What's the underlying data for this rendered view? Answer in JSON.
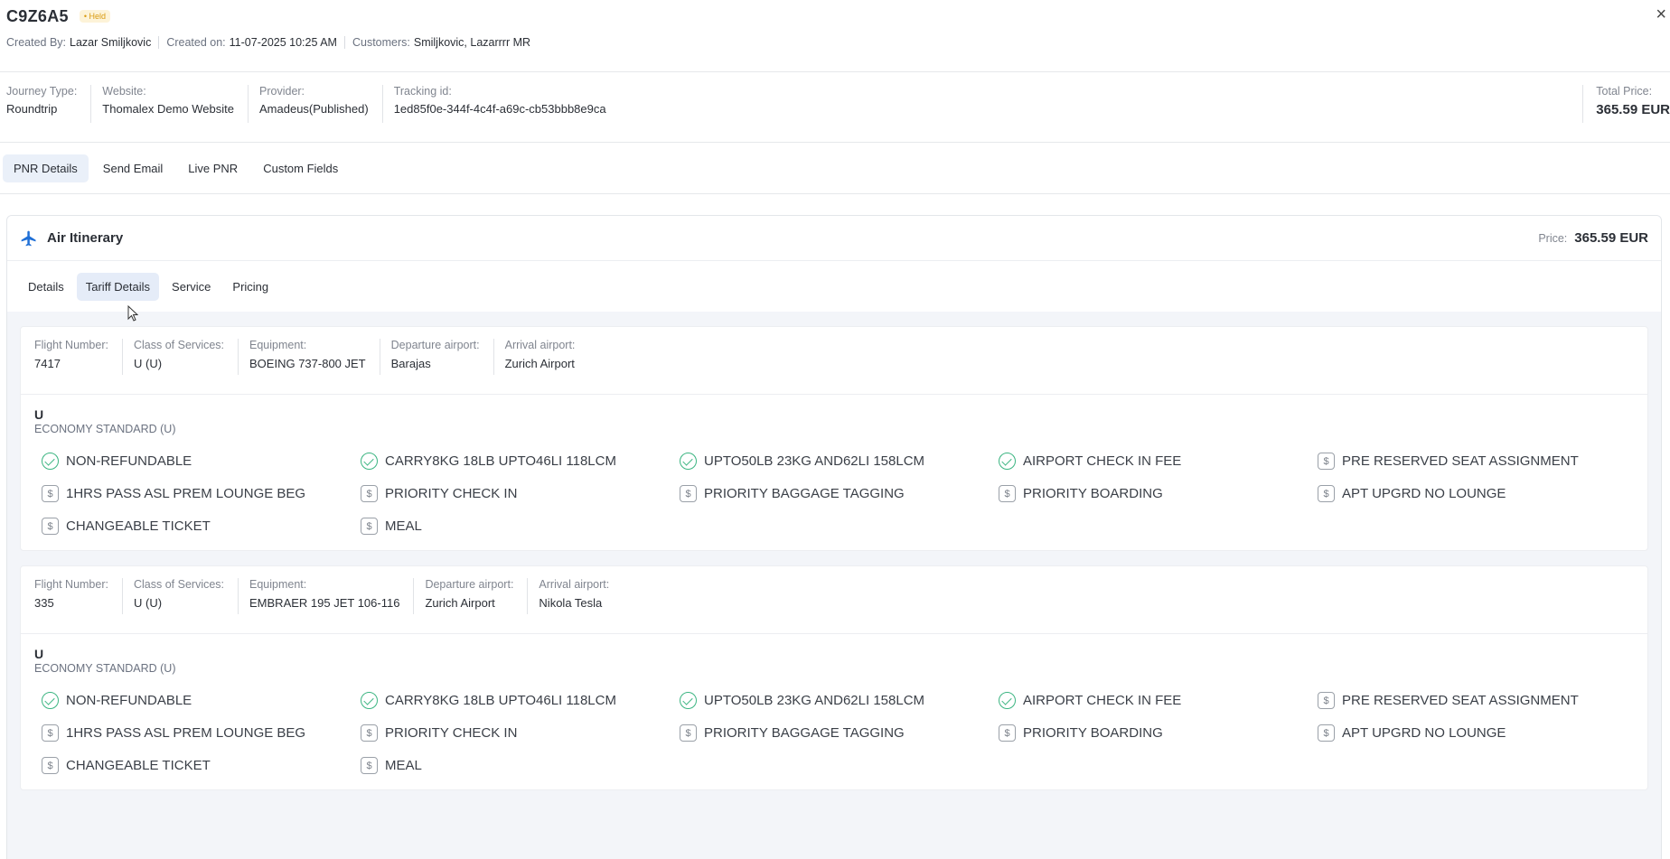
{
  "header": {
    "pnr_code": "C9Z6A5",
    "status_badge": "• Held",
    "created_by_label": "Created By:",
    "created_by_value": "Lazar Smiljkovic",
    "created_on_label": "Created on:",
    "created_on_value": "11-07-2025 10:25 AM",
    "customers_label": "Customers:",
    "customers_value": "Smiljkovic, Lazarrrr MR",
    "close_icon": "×"
  },
  "info": {
    "journey_type_label": "Journey Type:",
    "journey_type_value": "Roundtrip",
    "website_label": "Website:",
    "website_value": "Thomalex Demo Website",
    "provider_label": "Provider:",
    "provider_value": "Amadeus(Published)",
    "tracking_label": "Tracking id:",
    "tracking_value": "1ed85f0e-344f-4c4f-a69c-cb53bbb8e9ca",
    "total_price_label": "Total Price:",
    "total_price_value": "365.59 EUR"
  },
  "main_tabs": [
    "PNR Details",
    "Send Email",
    "Live PNR",
    "Custom Fields"
  ],
  "panel": {
    "title": "Air Itinerary",
    "price_label": "Price:",
    "price_value": "365.59 EUR",
    "sub_tabs": [
      "Details",
      "Tariff Details",
      "Service",
      "Pricing"
    ]
  },
  "flight_labels": {
    "flight_number": "Flight Number:",
    "class": "Class of Services:",
    "equipment": "Equipment:",
    "departure": "Departure airport:",
    "arrival": "Arrival airport:"
  },
  "flights": [
    {
      "flight_number": "7417",
      "class": "U (U)",
      "equipment": "BOEING 737-800 JET",
      "departure": "Barajas",
      "arrival": "Zurich Airport",
      "fare_code": "U",
      "fare_name": "ECONOMY STANDARD (U)"
    },
    {
      "flight_number": "335",
      "class": "U (U)",
      "equipment": "EMBRAER 195 JET 106-116",
      "departure": "Zurich Airport",
      "arrival": "Nikola Tesla",
      "fare_code": "U",
      "fare_name": "ECONOMY STANDARD (U)"
    }
  ],
  "features": [
    {
      "label": "NON-REFUNDABLE",
      "icon": "check-circle-icon"
    },
    {
      "label": "CARRY8KG 18LB UPTO46LI 118LCM",
      "icon": "check-circle-icon"
    },
    {
      "label": "UPTO50LB 23KG AND62LI 158LCM",
      "icon": "check-circle-icon"
    },
    {
      "label": "AIRPORT CHECK IN FEE",
      "icon": "check-circle-icon"
    },
    {
      "label": "PRE RESERVED SEAT ASSIGNMENT",
      "icon": "dollar-icon"
    },
    {
      "label": "1HRS PASS ASL PREM LOUNGE BEG",
      "icon": "dollar-icon"
    },
    {
      "label": "PRIORITY CHECK IN",
      "icon": "dollar-icon"
    },
    {
      "label": "PRIORITY BAGGAGE TAGGING",
      "icon": "dollar-icon"
    },
    {
      "label": "PRIORITY BOARDING",
      "icon": "dollar-icon"
    },
    {
      "label": "APT UPGRD NO LOUNGE",
      "icon": "dollar-icon"
    },
    {
      "label": "CHANGEABLE TICKET",
      "icon": "dollar-icon"
    },
    {
      "label": "MEAL",
      "icon": "dollar-icon"
    }
  ],
  "colors": {
    "accent": "#1f6fd6",
    "check_green": "#3cb582",
    "held_badge": "#d99a10",
    "active_tab_bg": "#eaf0f9"
  }
}
